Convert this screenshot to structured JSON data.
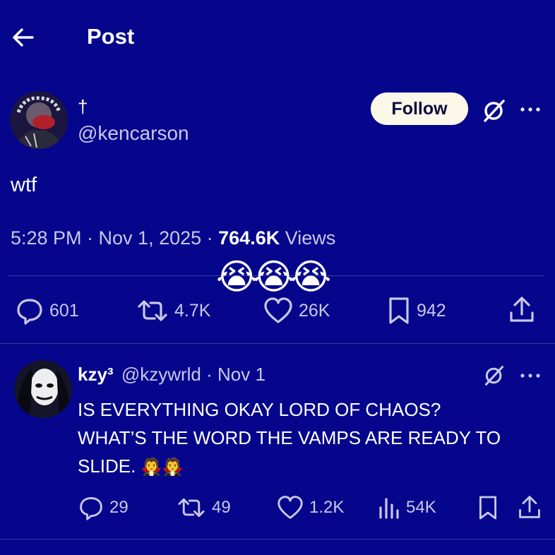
{
  "header": {
    "title": "Post"
  },
  "post": {
    "display_name": "†",
    "handle": "@kencarson",
    "follow_label": "Follow",
    "text": "wtf",
    "meta_time": "5:28 PM · Nov 1, 2025 · ",
    "views_count": "764.6K",
    "views_label": " Views",
    "emoji_overlay": "😭😭😭",
    "stats": {
      "replies": "601",
      "reposts": "4.7K",
      "likes": "26K",
      "bookmarks": "942"
    }
  },
  "reply": {
    "display_name": "kzy³",
    "handle": "@kzywrld",
    "date": "· Nov 1",
    "text_line1": "IS EVERYTHING OKAY LORD OF CHAOS?",
    "text_line2": "WHAT’S THE WORD THE VAMPS ARE READY TO",
    "text_line3": "SLIDE.",
    "emoji": "🧛🧛",
    "stats": {
      "replies": "29",
      "reposts": "49",
      "likes": "1.2K",
      "views": "54K"
    }
  },
  "colors": {
    "background": "#06068c",
    "follow_button": "#fbf8e9",
    "muted": "#c8c8e8"
  }
}
